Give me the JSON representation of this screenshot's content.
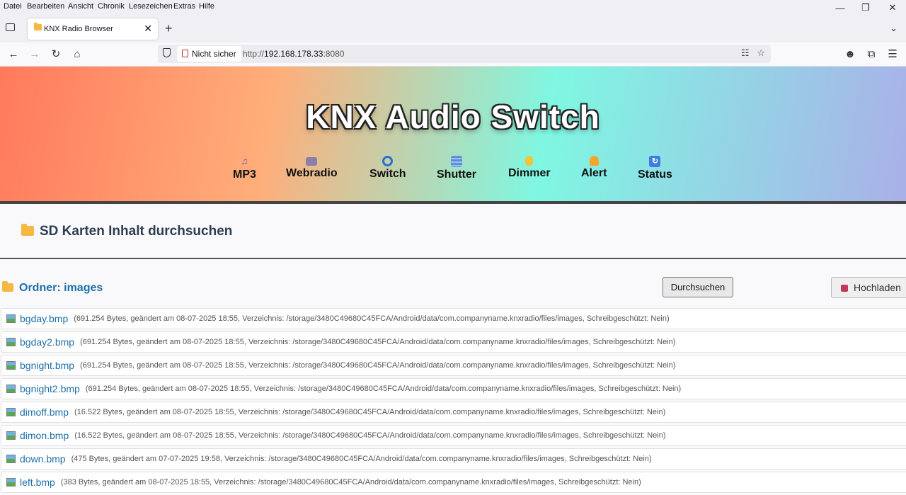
{
  "menubar": {
    "items": [
      "Datei",
      "Bearbeiten",
      "Ansicht",
      "Chronik",
      "Lesezeichen",
      "Extras",
      "Hilfe"
    ]
  },
  "window_controls": {
    "minimize": "—",
    "restore": "❐",
    "close": "✕"
  },
  "tab": {
    "title": "KNX Radio Browser",
    "close": "✕",
    "new_tab": "+"
  },
  "navbar": {
    "security_label": "Nicht sicher",
    "url_prefix": "http://",
    "url_host": "192.168.178.33",
    "url_port": ":8080"
  },
  "banner": {
    "title": "KNX Audio Switch",
    "nav": [
      {
        "label": "MP3",
        "icon": "music-note-icon",
        "color": "#6b4fbb"
      },
      {
        "label": "Webradio",
        "icon": "radio-icon",
        "color": "#8a7fa8"
      },
      {
        "label": "Switch",
        "icon": "switch-icon",
        "color": "#2a6fd1"
      },
      {
        "label": "Shutter",
        "icon": "shutter-icon",
        "color": "#5d8fd6"
      },
      {
        "label": "Dimmer",
        "icon": "lightbulb-icon",
        "color": "#f3c532"
      },
      {
        "label": "Alert",
        "icon": "bell-icon",
        "color": "#f4a62a"
      },
      {
        "label": "Status",
        "icon": "refresh-icon",
        "color": "#3d7de0"
      }
    ]
  },
  "content": {
    "section_title": "SD Karten Inhalt durchsuchen",
    "folder_title": "Ordner: images",
    "browse_button": "Durchsuchen",
    "upload_button": "Hochladen"
  },
  "files": [
    {
      "name": "bgday.bmp",
      "meta": "(691.254 Bytes, geändert am 08-07-2025 18:55, Verzeichnis: /storage/3480C49680C45FCA/Android/data/com.companyname.knxradio/files/images, Schreibgeschützt: Nein)"
    },
    {
      "name": "bgday2.bmp",
      "meta": "(691.254 Bytes, geändert am 08-07-2025 18:55, Verzeichnis: /storage/3480C49680C45FCA/Android/data/com.companyname.knxradio/files/images, Schreibgeschützt: Nein)"
    },
    {
      "name": "bgnight.bmp",
      "meta": "(691.254 Bytes, geändert am 08-07-2025 18:55, Verzeichnis: /storage/3480C49680C45FCA/Android/data/com.companyname.knxradio/files/images, Schreibgeschützt: Nein)"
    },
    {
      "name": "bgnight2.bmp",
      "meta": "(691.254 Bytes, geändert am 08-07-2025 18:55, Verzeichnis: /storage/3480C49680C45FCA/Android/data/com.companyname.knxradio/files/images, Schreibgeschützt: Nein)"
    },
    {
      "name": "dimoff.bmp",
      "meta": "(16.522 Bytes, geändert am 08-07-2025 18:55, Verzeichnis: /storage/3480C49680C45FCA/Android/data/com.companyname.knxradio/files/images, Schreibgeschützt: Nein)"
    },
    {
      "name": "dimon.bmp",
      "meta": "(16.522 Bytes, geändert am 08-07-2025 18:55, Verzeichnis: /storage/3480C49680C45FCA/Android/data/com.companyname.knxradio/files/images, Schreibgeschützt: Nein)"
    },
    {
      "name": "down.bmp",
      "meta": "(475 Bytes, geändert am 07-07-2025 19:58, Verzeichnis: /storage/3480C49680C45FCA/Android/data/com.companyname.knxradio/files/images, Schreibgeschützt: Nein)"
    },
    {
      "name": "left.bmp",
      "meta": "(383 Bytes, geändert am 08-07-2025 18:55, Verzeichnis: /storage/3480C49680C45FCA/Android/data/com.companyname.knxradio/files/images, Schreibgeschützt: Nein)"
    }
  ]
}
